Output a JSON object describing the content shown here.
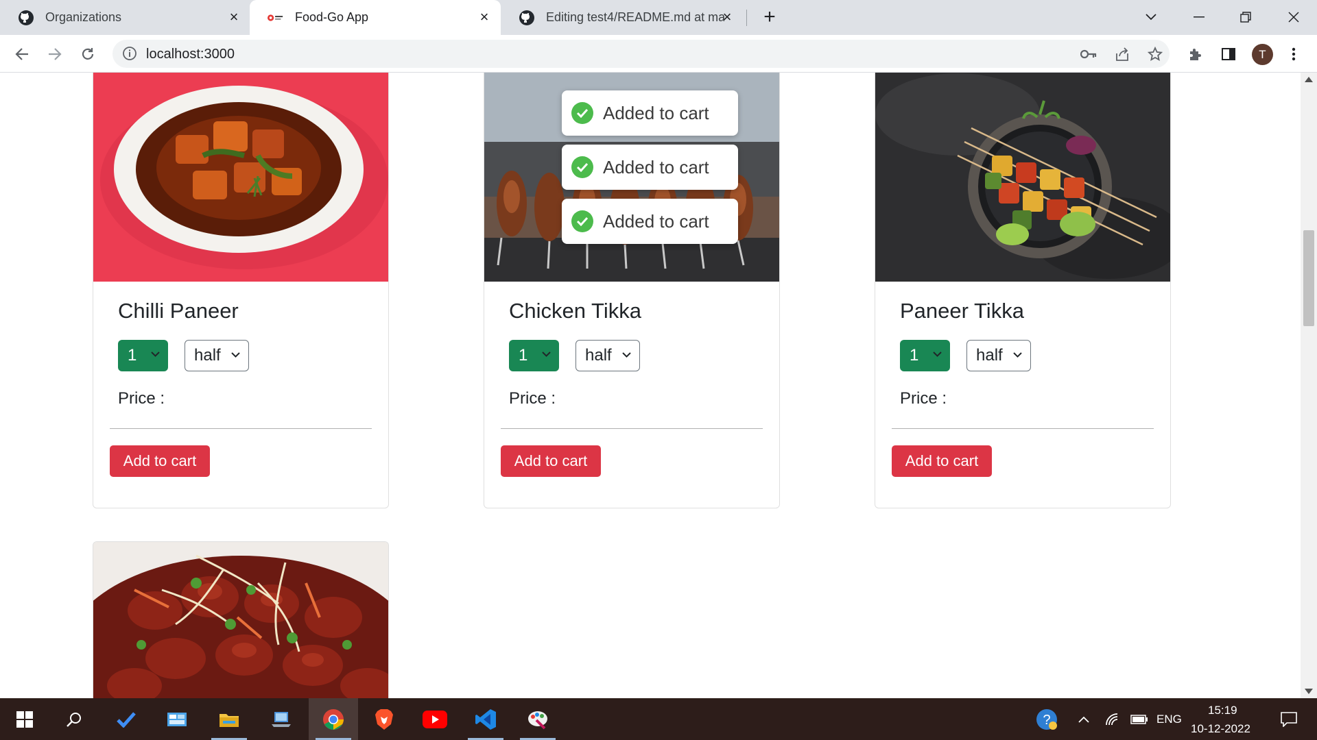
{
  "browser": {
    "tabs": [
      {
        "title": "Organizations",
        "icon": "github-icon",
        "active": false
      },
      {
        "title": "Food-Go App",
        "icon": "food-go-favicon-icon",
        "active": true
      },
      {
        "title": "Editing test4/README.md at mai",
        "icon": "github-icon",
        "active": false
      }
    ],
    "address": "localhost:3000",
    "profile_initial": "T"
  },
  "toasts": [
    {
      "text": "Added to cart",
      "icon": "check-circle-icon"
    },
    {
      "text": "Added to cart",
      "icon": "check-circle-icon"
    },
    {
      "text": "Added to cart",
      "icon": "check-circle-icon"
    }
  ],
  "cards": [
    {
      "title": "Chilli Paneer",
      "qty": "1",
      "size": "half",
      "price_label": "Price :",
      "button": "Add to cart"
    },
    {
      "title": "Chicken Tikka",
      "qty": "1",
      "size": "half",
      "price_label": "Price :",
      "button": "Add to cart"
    },
    {
      "title": "Paneer Tikka",
      "qty": "1",
      "size": "half",
      "price_label": "Price :",
      "button": "Add to cart"
    }
  ],
  "taskbar": {
    "language": "ENG",
    "time": "15:19",
    "date": "10-12-2022",
    "apps": [
      "windows-start-icon",
      "search-icon",
      "todo-icon",
      "control-panel-icon",
      "file-explorer-icon",
      "laptop-icon",
      "chrome-icon",
      "brave-icon",
      "youtube-icon",
      "vscode-icon",
      "paint-icon"
    ]
  },
  "colors": {
    "tab_bar": "#dee1e6",
    "success_select": "#198754",
    "danger_button": "#dc3545",
    "toast_check": "#4cbb4c",
    "taskbar": "#2d1d1a"
  }
}
